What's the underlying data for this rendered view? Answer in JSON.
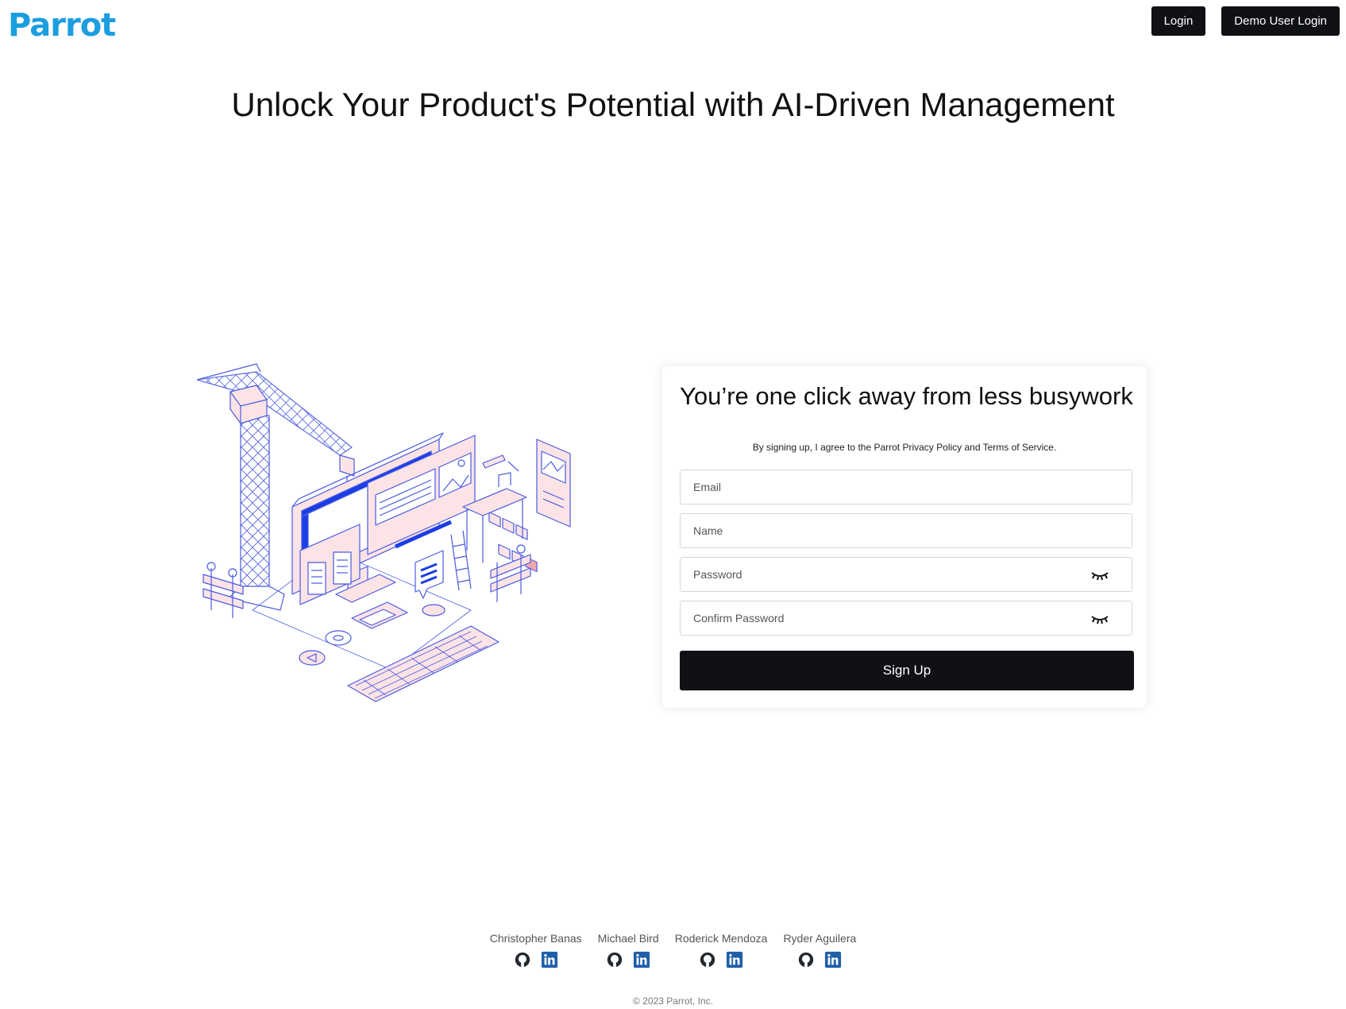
{
  "header": {
    "logo_text": "Parrot",
    "logo_color": "#1b9ee0",
    "login_label": "Login",
    "demo_login_label": "Demo User Login"
  },
  "hero": {
    "title": "Unlock Your Product's Potential with AI-Driven Management"
  },
  "signup": {
    "title": "You’re one click away from less busywork",
    "terms": "By signing up, I agree to the Parrot Privacy Policy and Terms of Service.",
    "email_placeholder": "Email",
    "name_placeholder": "Name",
    "password_placeholder": "Password",
    "confirm_password_placeholder": "Confirm Password",
    "password_toggle_icon": "eye-closed-icon",
    "submit_label": "Sign Up"
  },
  "footer": {
    "team": [
      {
        "name": "Christopher Banas"
      },
      {
        "name": "Michael Bird"
      },
      {
        "name": "Roderick Mendoza"
      },
      {
        "name": "Ryder Aguilera"
      }
    ],
    "icons": [
      "github-icon",
      "linkedin-icon"
    ],
    "copyright": "© 2023 Parrot, Inc."
  },
  "colors": {
    "accent": "#1b9ee0",
    "button_bg": "#0f1115",
    "illustration_line": "#4a5be0",
    "illustration_fill": "#fbe3e6",
    "illustration_blue": "#1a3de6"
  }
}
